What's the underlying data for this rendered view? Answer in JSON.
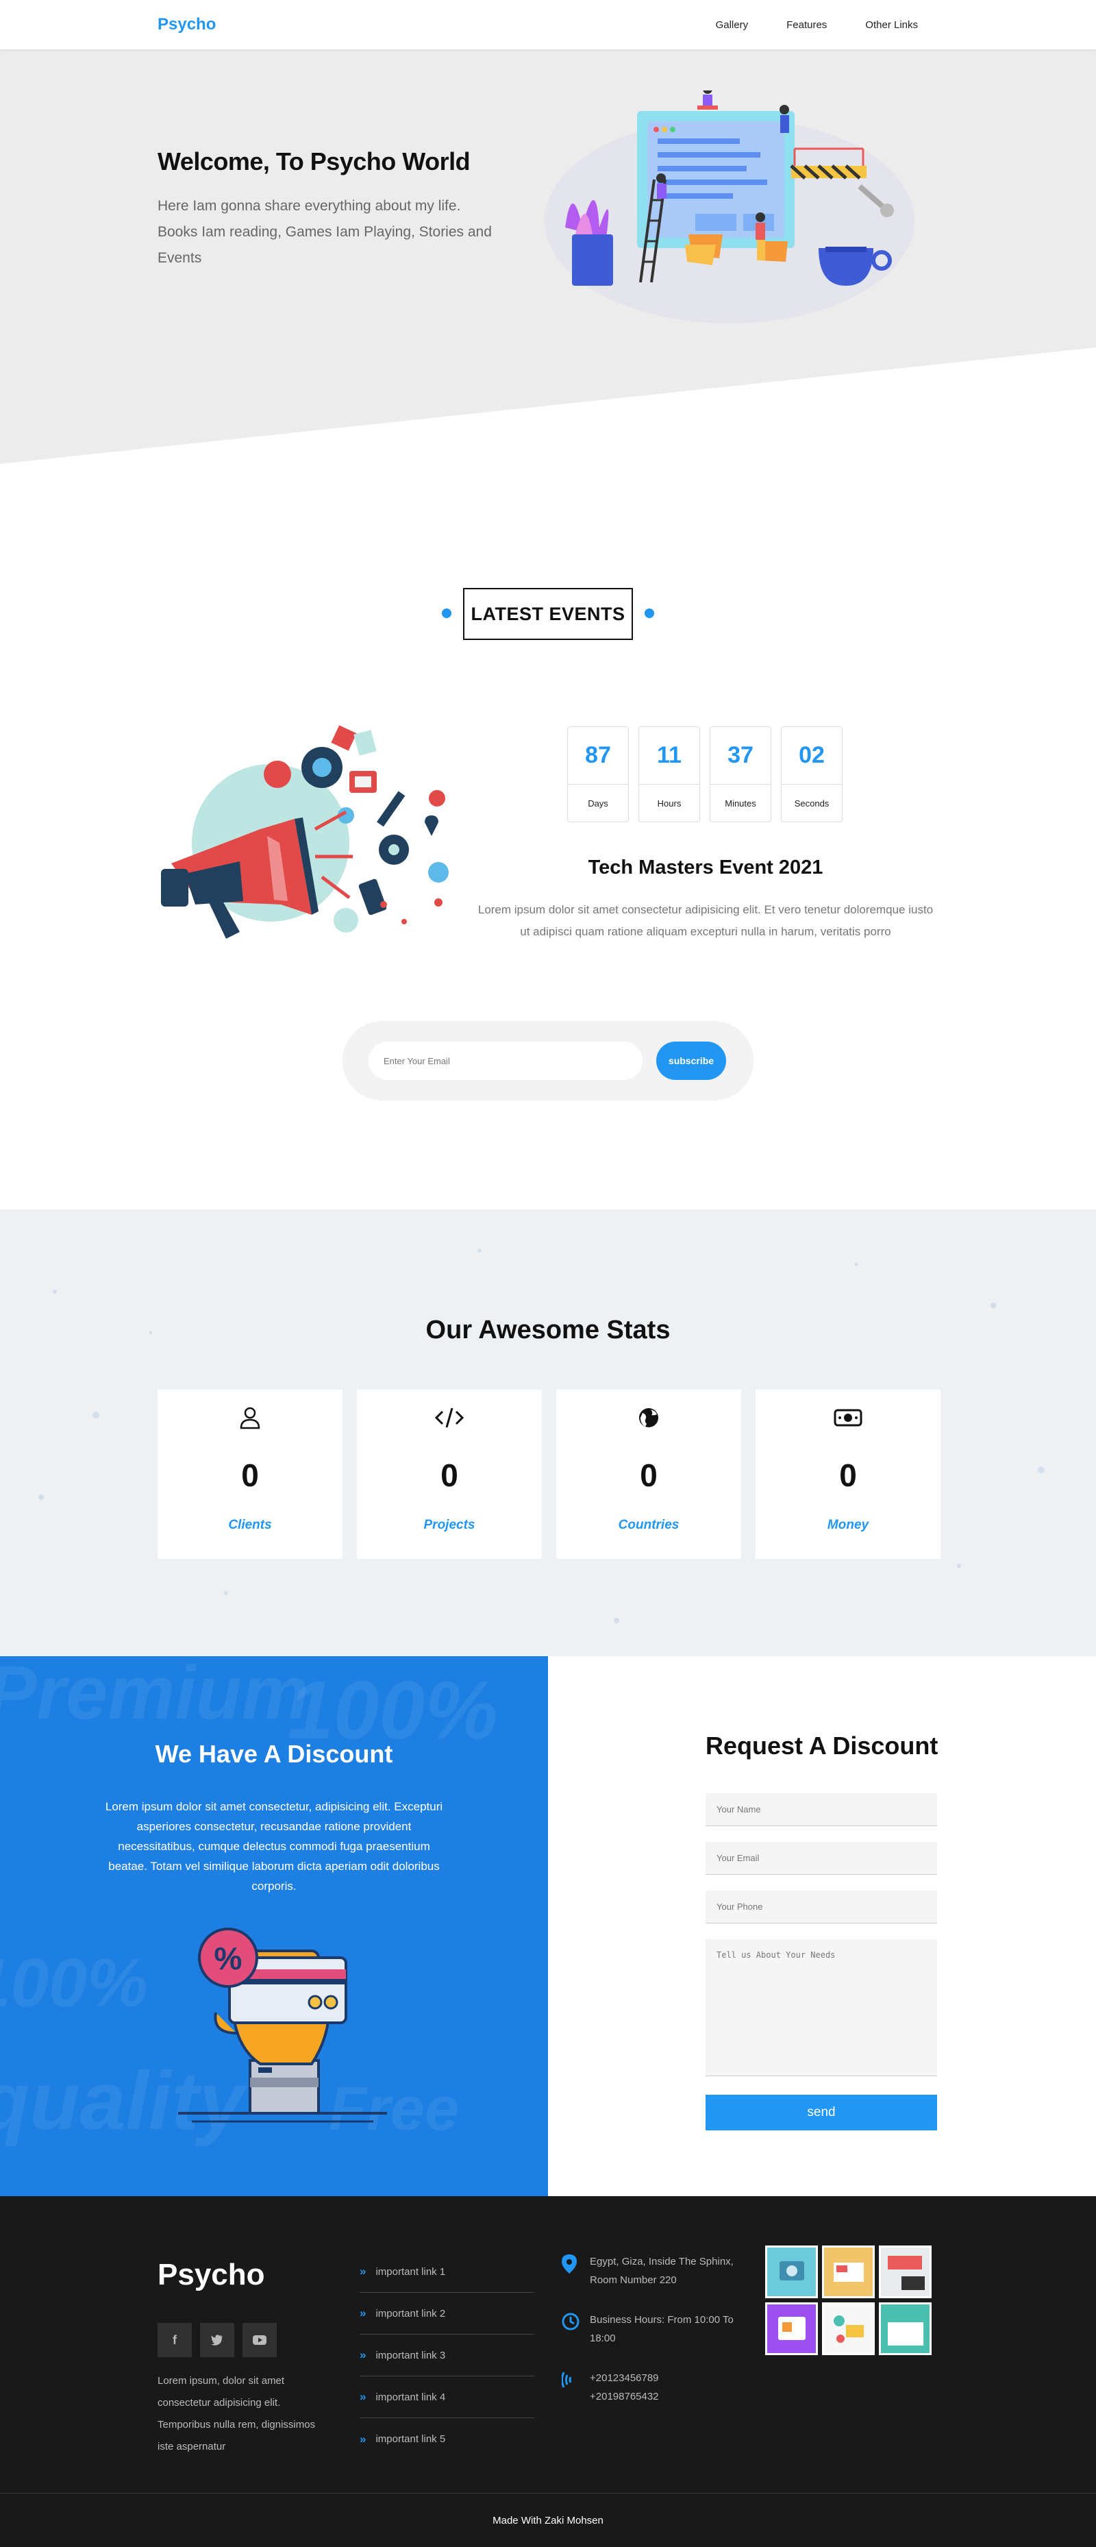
{
  "header": {
    "logo": "Psycho",
    "nav": [
      "Gallery",
      "Features",
      "Other Links"
    ]
  },
  "hero": {
    "title": "Welcome, To Psycho World",
    "text": "Here Iam gonna share everything about my life. Books Iam reading, Games Iam Playing, Stories and Events"
  },
  "events": {
    "section_title": "LATEST EVENTS",
    "countdown": [
      {
        "value": "87",
        "label": "Days"
      },
      {
        "value": "11",
        "label": "Hours"
      },
      {
        "value": "37",
        "label": "Minutes"
      },
      {
        "value": "02",
        "label": "Seconds"
      }
    ],
    "title": "Tech Masters Event 2021",
    "text": "Lorem ipsum dolor sit amet consectetur adipisicing elit. Et vero tenetur doloremque iusto ut adipisci quam ratione aliquam excepturi nulla in harum, veritatis porro",
    "subscribe": {
      "placeholder": "Enter Your Email",
      "button": "subscribe"
    }
  },
  "stats": {
    "title": "Our Awesome Stats",
    "items": [
      {
        "icon": "user-icon",
        "value": "0",
        "label": "Clients"
      },
      {
        "icon": "code-icon",
        "value": "0",
        "label": "Projects"
      },
      {
        "icon": "globe-icon",
        "value": "0",
        "label": "Countries"
      },
      {
        "icon": "money-icon",
        "value": "0",
        "label": "Money"
      }
    ]
  },
  "discount": {
    "title": "We Have A Discount",
    "text": "Lorem ipsum dolor sit amet consectetur, adipisicing elit. Excepturi asperiores consectetur, recusandae ratione provident necessitatibus, cumque delectus commodi fuga praesentium beatae. Totam vel similique laborum dicta aperiam odit doloribus corporis.",
    "form_title": "Request A Discount",
    "fields": {
      "name": "Your Name",
      "email": "Your Email",
      "phone": "Your Phone",
      "needs": "Tell us About Your Needs"
    },
    "send": "send"
  },
  "footer": {
    "logo": "Psycho",
    "socials": [
      "f",
      "t",
      "▶"
    ],
    "text": "Lorem ipsum, dolor sit amet consectetur adipisicing elit. Temporibus nulla rem, dignissimos iste aspernatur",
    "links": [
      "important link 1",
      "important link 2",
      "important link 3",
      "important link 4",
      "important link 5"
    ],
    "address": "Egypt, Giza, Inside The Sphinx, Room Number 220",
    "hours": "Business Hours: From 10:00 To 18:00",
    "phone1": "+20123456789",
    "phone2": "+20198765432",
    "credit": "Made With Zaki Mohsen"
  },
  "colors": {
    "accent": "#2196f3",
    "discount_bg": "#1e7fe2",
    "footer_bg": "#191919"
  }
}
